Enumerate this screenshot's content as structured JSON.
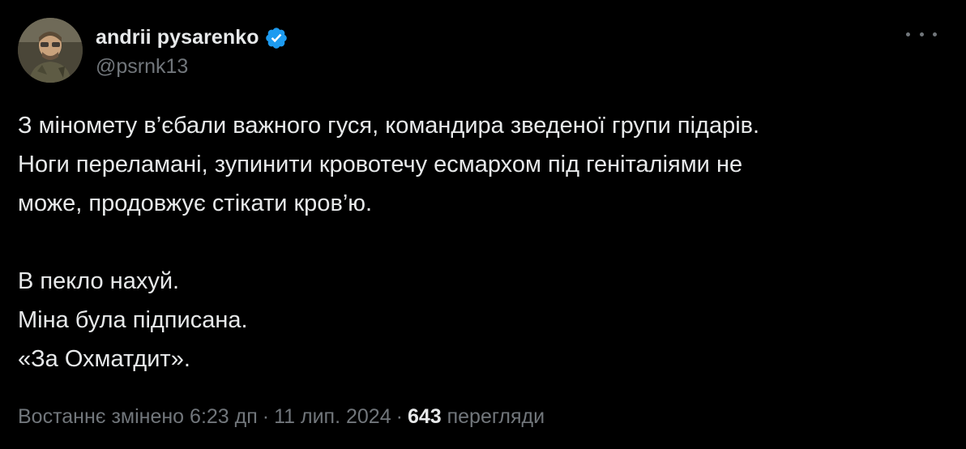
{
  "author": {
    "display_name": "andrii pysarenko",
    "handle": "@psrnk13",
    "verified": true,
    "avatar_icon": "user-avatar-photo",
    "verified_icon": "verified-badge-icon"
  },
  "menu": {
    "more_icon": "more-options-icon"
  },
  "tweet": {
    "lines": [
      "З міномету в’єбали важного гуся, командира зведеної групи підарів.",
      "Ноги переламані, зупинити кровотечу есмархом під геніталіями не",
      "може, продовжує стікати кров’ю.",
      "В пекло нахуй.",
      "Міна була підписана.",
      "«За Охматдит»."
    ]
  },
  "meta": {
    "edited_label": "Востаннє змінено",
    "time": "6:23 дп",
    "separator": "·",
    "date": "11 лип. 2024",
    "views_count": "643",
    "views_label": "перегляди"
  },
  "colors": {
    "background": "#000000",
    "text_primary": "#e7e9ea",
    "text_secondary": "#71767b",
    "verified_blue": "#1d9bf0"
  }
}
